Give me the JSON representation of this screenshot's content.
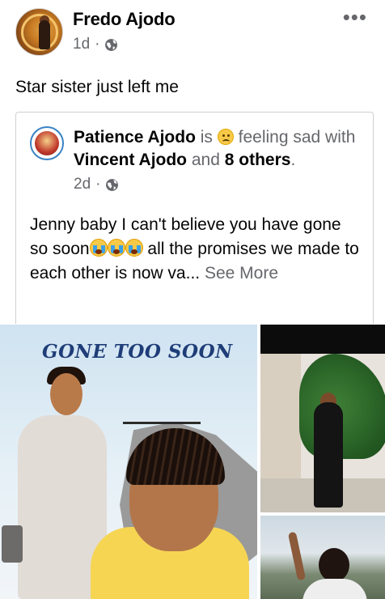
{
  "post": {
    "author": "Fredo Ajodo",
    "time": "1d",
    "separator": "·",
    "privacy_icon": "globe-icon",
    "more_label": "•••",
    "text": "Star sister just left me"
  },
  "shared_post": {
    "author": "Patience Ajodo",
    "is_text": "is",
    "feeling_emoji": "sad-face-icon",
    "feeling_text": "feeling sad",
    "with_text": "with",
    "tagged_person": "Vincent Ajodo",
    "and_text": "and",
    "others_text": "8 others",
    "period": ".",
    "time": "2d",
    "separator": "·",
    "privacy_icon": "globe-icon",
    "body_part1": "Jenny baby I can't believe you have gone so soon",
    "body_emoji": "crying-face-icon",
    "body_part2": " all the promises we made to each other is now va... ",
    "see_more": "See More"
  },
  "photos": {
    "main_caption": "GONE TOO SOON"
  },
  "colors": {
    "text_primary": "#050505",
    "text_secondary": "#65676b",
    "border": "#ced0d4",
    "caption_blue": "#1f3d78"
  }
}
